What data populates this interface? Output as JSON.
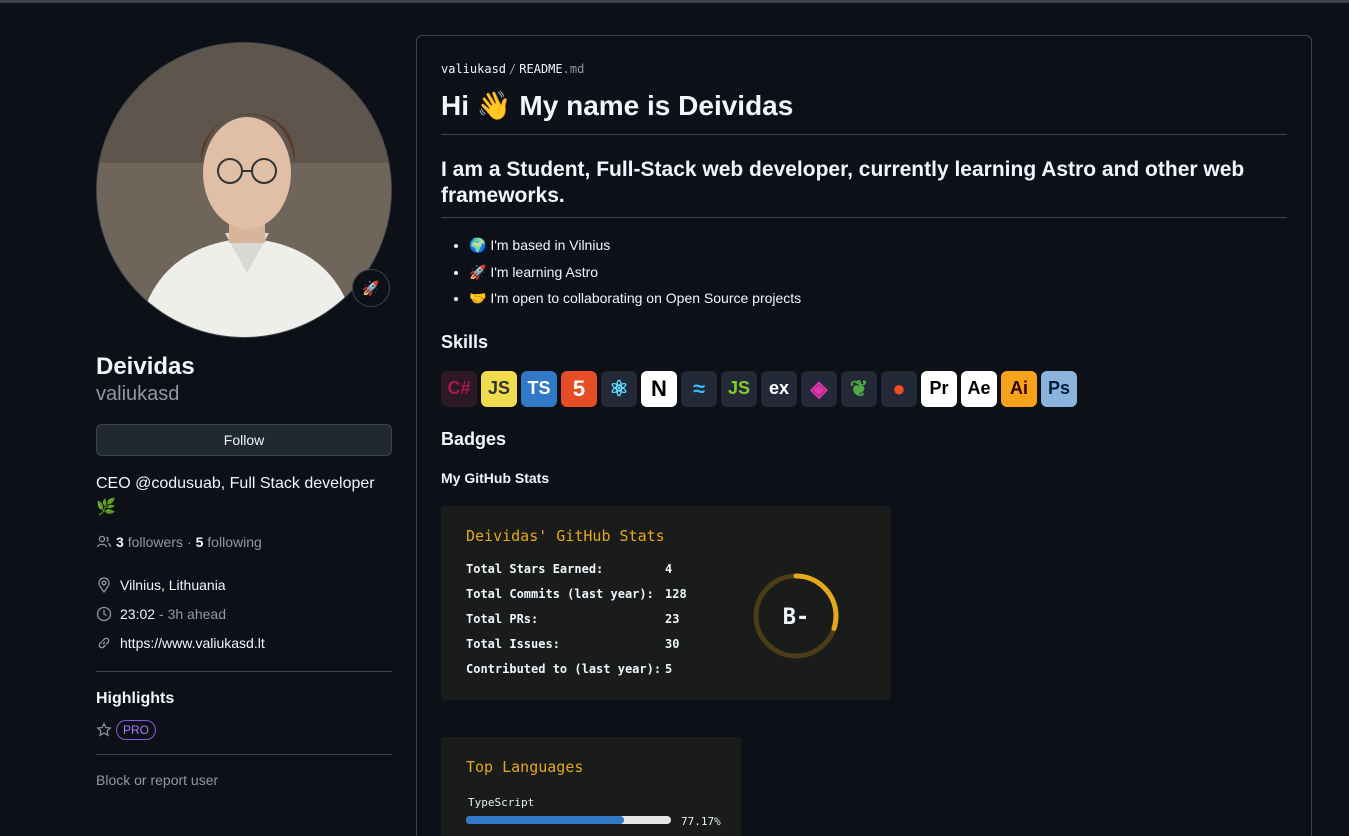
{
  "profile": {
    "name": "Deividas",
    "login": "valiukasd",
    "status_emoji": "🚀",
    "follow_label": "Follow",
    "bio": "CEO @codusuab, Full Stack developer 🌿",
    "followers_count": "3",
    "followers_label": "followers",
    "following_count": "5",
    "following_label": "following",
    "location": "Vilnius, Lithuania",
    "local_time": "23:02",
    "time_offset": "- 3h ahead",
    "website": "https://www.valiukasd.lt",
    "highlights_title": "Highlights",
    "pro_badge": "PRO",
    "block_label": "Block or report user"
  },
  "readme": {
    "crumb_user": "valiukasd",
    "crumb_sep": "/",
    "crumb_file": "README",
    "crumb_ext": ".md",
    "heading": "Hi 👋 My name is Deividas",
    "intro": "I am a Student, Full-Stack web developer, currently learning Astro and other web frameworks.",
    "facts": [
      "🌍  I'm based in Vilnius",
      "🚀  I'm learning Astro",
      "🤝  I'm open to collaborating on Open Source projects"
    ],
    "skills_title": "Skills",
    "skills": [
      {
        "icon": "csharp-icon",
        "text": "C#",
        "bg": "#2b1a26",
        "fg": "#a8174e"
      },
      {
        "icon": "javascript-icon",
        "text": "JS",
        "bg": "#f0db4f",
        "fg": "#323330"
      },
      {
        "icon": "typescript-icon",
        "text": "TS",
        "bg": "#3178c6",
        "fg": "#ffffff"
      },
      {
        "icon": "html5-icon",
        "text": "5",
        "bg": "#e44d26",
        "fg": "#ffffff"
      },
      {
        "icon": "react-icon",
        "text": "⚛",
        "bg": "#242938",
        "fg": "#61dafb"
      },
      {
        "icon": "nextjs-icon",
        "text": "N",
        "bg": "#ffffff",
        "fg": "#000000"
      },
      {
        "icon": "tailwind-icon",
        "text": "≈",
        "bg": "#242938",
        "fg": "#38bdf8"
      },
      {
        "icon": "nodejs-icon",
        "text": "JS",
        "bg": "#242938",
        "fg": "#83cd29"
      },
      {
        "icon": "express-icon",
        "text": "ex",
        "bg": "#242938",
        "fg": "#ffffff"
      },
      {
        "icon": "graphql-icon",
        "text": "◈",
        "bg": "#242938",
        "fg": "#e535ab"
      },
      {
        "icon": "mongodb-icon",
        "text": "❦",
        "bg": "#242938",
        "fg": "#4faa41"
      },
      {
        "icon": "figma-icon",
        "text": "●",
        "bg": "#242938",
        "fg": "#f24e1e"
      },
      {
        "icon": "premiere-icon",
        "text": "Pr",
        "bg": "#ffffff",
        "fg": "#000000"
      },
      {
        "icon": "aftereffects-icon",
        "text": "Ae",
        "bg": "#ffffff",
        "fg": "#000000"
      },
      {
        "icon": "illustrator-icon",
        "text": "Ai",
        "bg": "#f7a21b",
        "fg": "#330000"
      },
      {
        "icon": "photoshop-icon",
        "text": "Ps",
        "bg": "#8ab4de",
        "fg": "#001e36"
      }
    ],
    "badges_title": "Badges",
    "stats_heading": "My GitHub Stats"
  },
  "stats_card": {
    "title": "Deividas' GitHub Stats",
    "rows": [
      {
        "label": "Total Stars Earned:",
        "value": "4"
      },
      {
        "label": "Total Commits (last year):",
        "value": "128"
      },
      {
        "label": "Total PRs:",
        "value": "23"
      },
      {
        "label": "Total Issues:",
        "value": "30"
      },
      {
        "label": "Contributed to (last year):",
        "value": "5"
      }
    ],
    "rank": "B-",
    "rank_progress": 0.3,
    "accent": "#e6a81b"
  },
  "languages_card": {
    "title": "Top Languages",
    "lang_name": "TypeScript",
    "lang_pct_label": "77.17%",
    "lang_pct": 77.17,
    "lang_color": "#3178c6"
  }
}
